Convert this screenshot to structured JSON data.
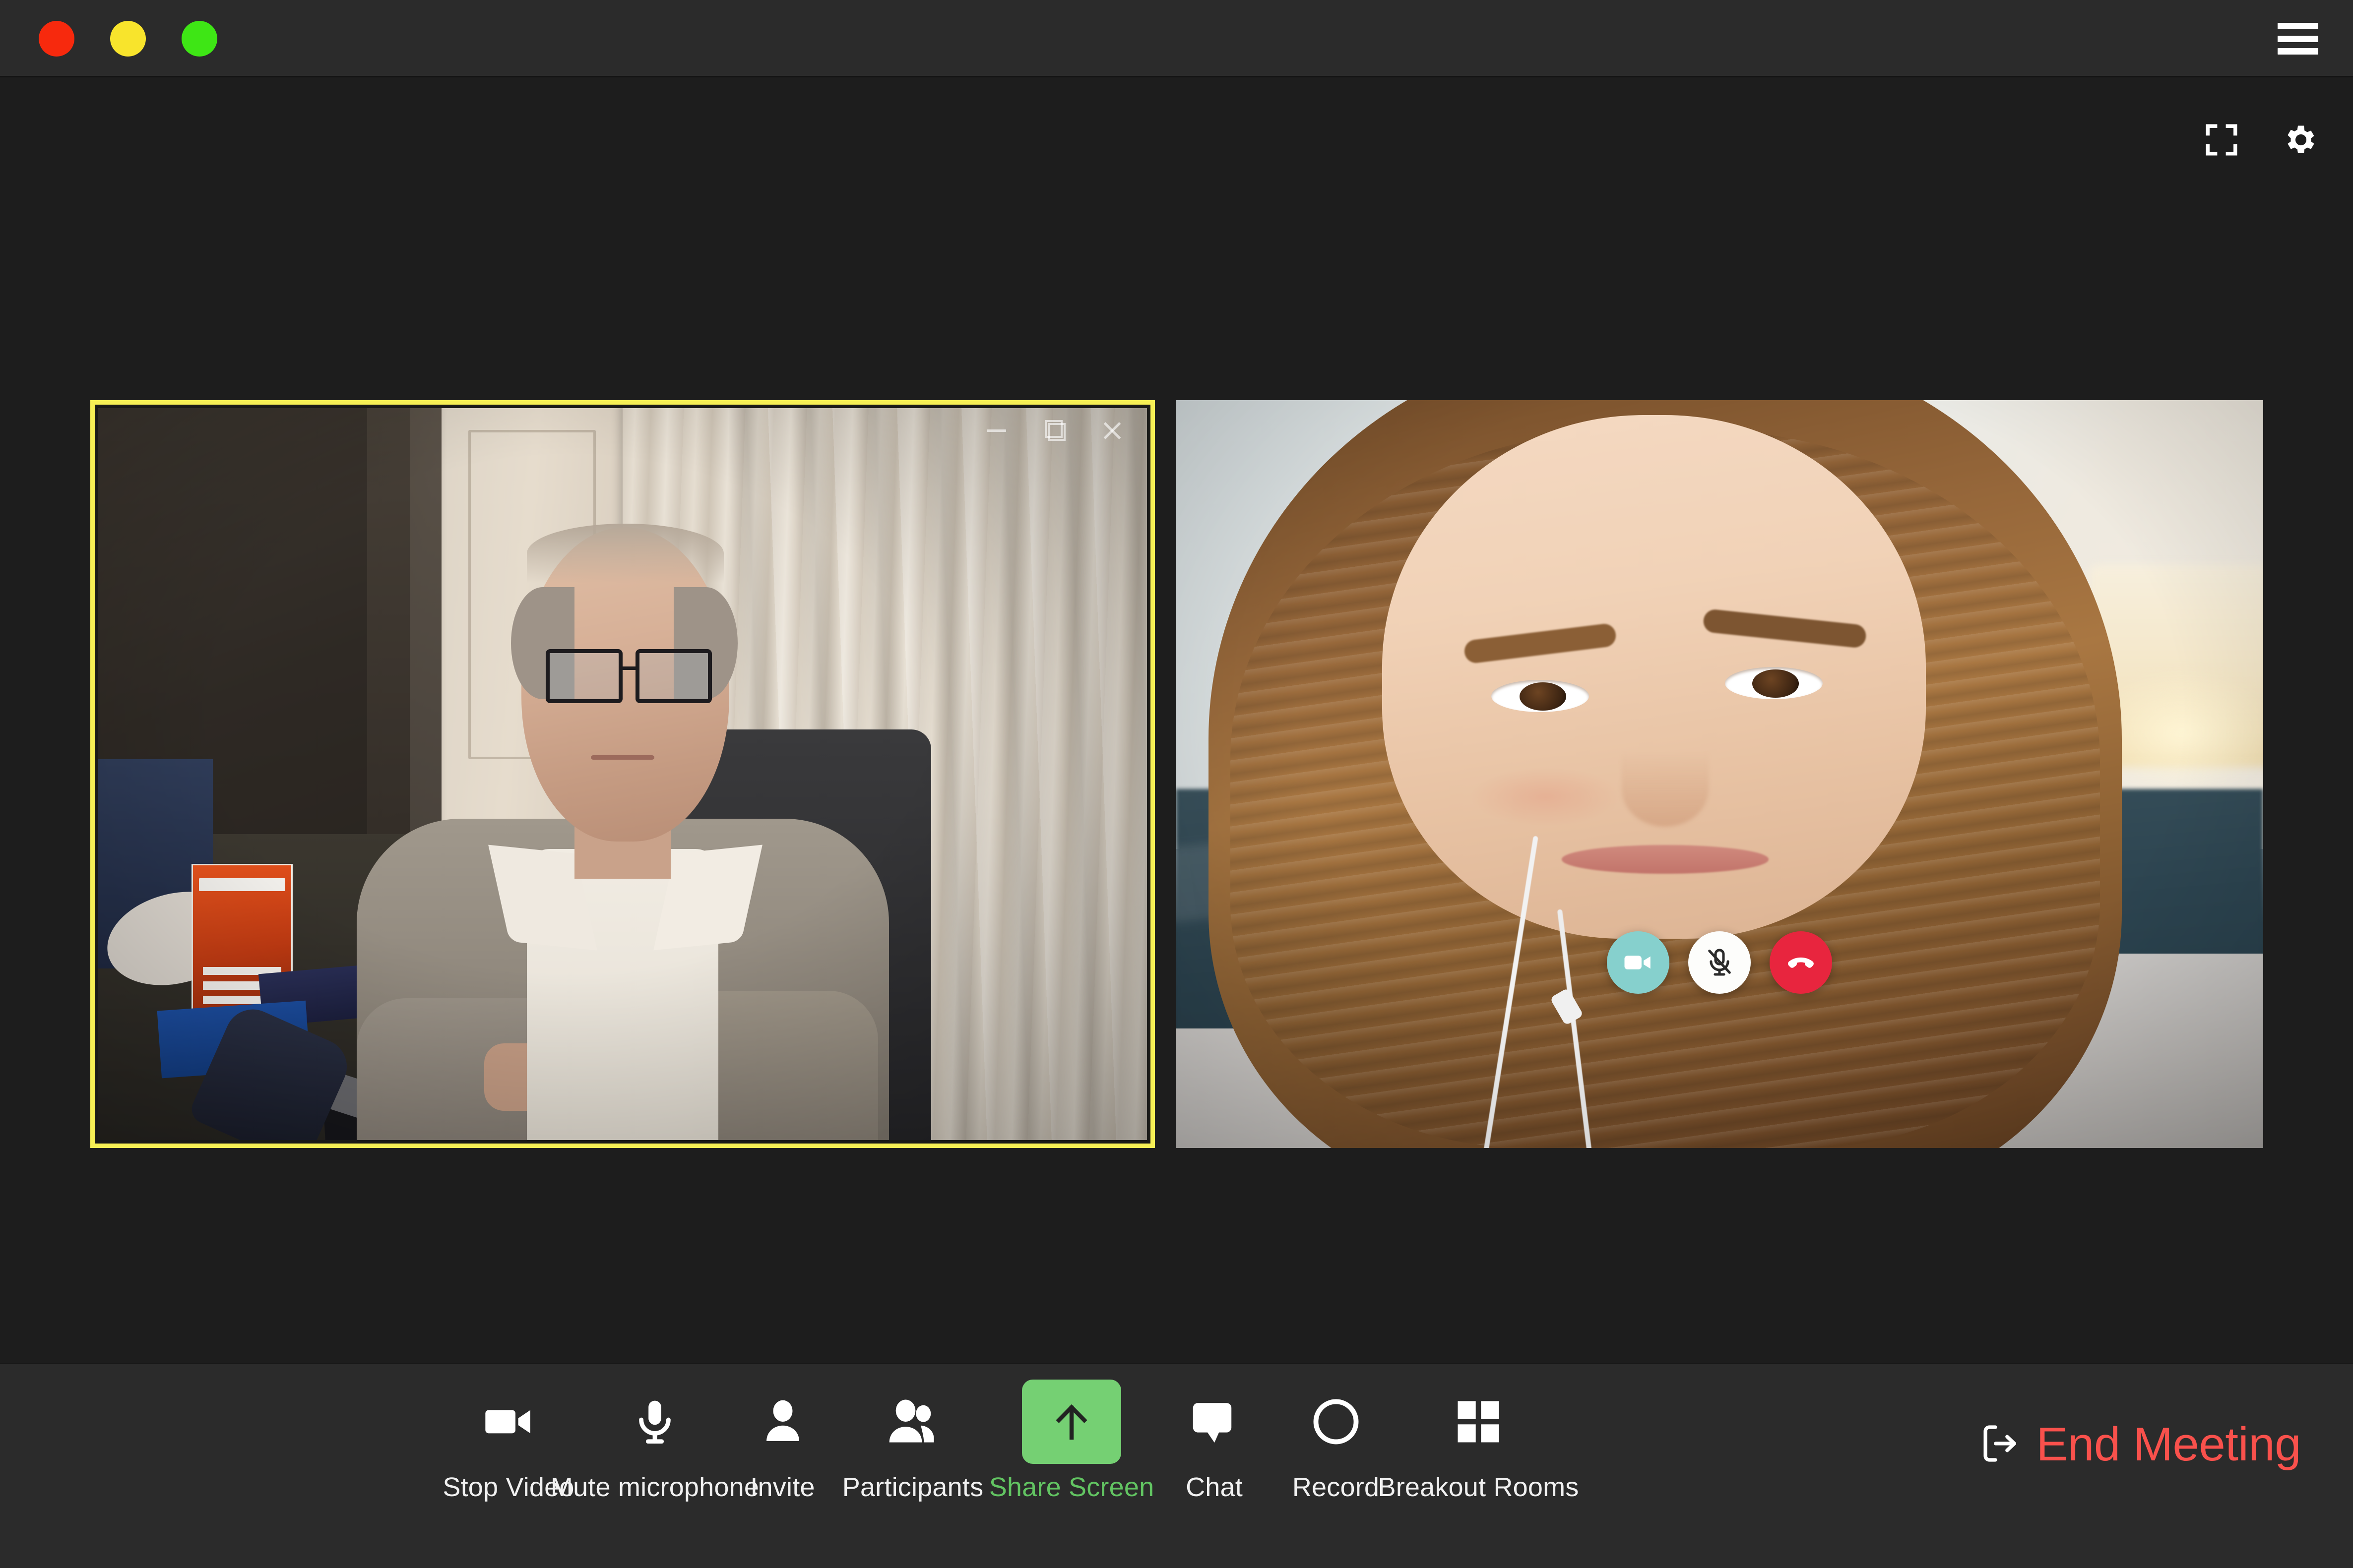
{
  "window": {
    "traffic_lights": [
      {
        "name": "close",
        "color": "#f7290d"
      },
      {
        "name": "minimize",
        "color": "#f8e42c"
      },
      {
        "name": "maximize",
        "color": "#3ee615"
      }
    ],
    "menu_icon": "hamburger-menu-icon"
  },
  "stage": {
    "controls": [
      {
        "name": "fullscreen-icon",
        "label": "Fullscreen"
      },
      {
        "name": "gear-icon",
        "label": "Settings"
      }
    ]
  },
  "tiles": [
    {
      "id": "participant-left",
      "active_speaker": true,
      "border_color": "#f6ef55",
      "embedded_window_controls": [
        {
          "name": "minimize-icon"
        },
        {
          "name": "restore-icon"
        },
        {
          "name": "close-icon"
        }
      ]
    },
    {
      "id": "participant-right",
      "active_speaker": false,
      "overlay_controls": [
        {
          "name": "camera-icon",
          "label": "Camera on",
          "color": "#86d0cd",
          "state": "on"
        },
        {
          "name": "microphone-muted-icon",
          "label": "Microphone muted",
          "color": "#fdfdfb",
          "state": "muted"
        },
        {
          "name": "hang-up-icon",
          "label": "Leave call",
          "color": "#e8253e",
          "state": "active"
        }
      ]
    }
  ],
  "toolbar": {
    "items": [
      {
        "label": "Stop Video",
        "icon": "video-camera-icon",
        "accent": false
      },
      {
        "label": "Mute microphone",
        "icon": "microphone-icon",
        "accent": false
      },
      {
        "label": "Invite",
        "icon": "person-icon",
        "accent": false
      },
      {
        "label": "Participants",
        "icon": "people-group-icon",
        "accent": false
      },
      {
        "label": "Share Screen",
        "icon": "share-screen-icon",
        "accent": true,
        "accent_color": "#75d073",
        "label_color": "#62c462"
      },
      {
        "label": "Chat",
        "icon": "speech-bubble-icon",
        "accent": false
      },
      {
        "label": "Record",
        "icon": "record-circle-icon",
        "accent": false
      },
      {
        "label": "Breakout Rooms",
        "icon": "grid-four-icon",
        "accent": false
      }
    ],
    "end_meeting": {
      "label": "End Meeting",
      "icon": "exit-arrow-icon",
      "color": "#f9514c"
    }
  }
}
